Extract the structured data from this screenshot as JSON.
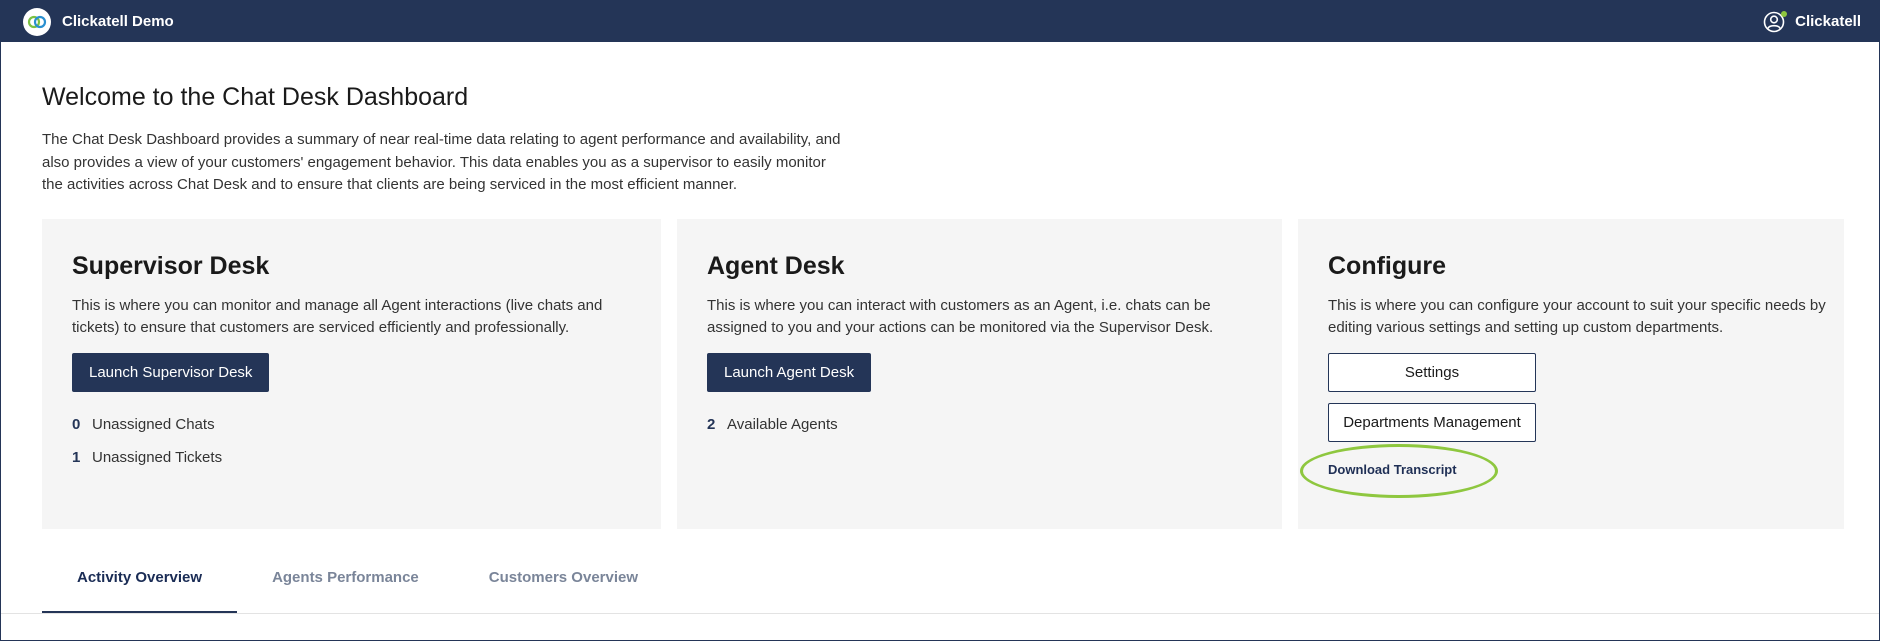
{
  "header": {
    "app_title": "Clickatell Demo",
    "user_name": "Clickatell",
    "brand_color": "#243557",
    "accent_color": "#8ec73f"
  },
  "welcome": {
    "title": "Welcome to the Chat Desk Dashboard",
    "description": "The Chat Desk Dashboard provides a summary of near real-time data relating to agent performance and availability, and also provides a view of your customers' engagement behavior. This data enables you as a supervisor to easily monitor the activities across Chat Desk and to ensure that clients are being serviced in the most efficient manner."
  },
  "cards": {
    "supervisor": {
      "title": "Supervisor Desk",
      "description": "This is where you can monitor and manage all Agent interactions (live chats and tickets) to ensure that customers are serviced efficiently and professionally.",
      "button": "Launch Supervisor Desk",
      "stats": [
        {
          "value": "0",
          "label": "Unassigned Chats"
        },
        {
          "value": "1",
          "label": "Unassigned Tickets"
        }
      ]
    },
    "agent": {
      "title": "Agent Desk",
      "description": "This is where you can interact with customers as an Agent, i.e. chats can be assigned to you and your actions can be monitored via the Supervisor Desk.",
      "button": "Launch Agent Desk",
      "stats": [
        {
          "value": "2",
          "label": "Available Agents"
        }
      ]
    },
    "configure": {
      "title": "Configure",
      "description": "This is where you can configure your account to suit your specific needs by editing various settings and setting up custom departments.",
      "settings_button": "Settings",
      "departments_button": "Departments Management",
      "download_link": "Download Transcript"
    }
  },
  "tabs": [
    {
      "label": "Activity Overview",
      "active": true
    },
    {
      "label": "Agents Performance",
      "active": false
    },
    {
      "label": "Customers Overview",
      "active": false
    }
  ],
  "icons": {
    "logo": "clickatell-logo-icon",
    "user": "user-account-icon"
  }
}
